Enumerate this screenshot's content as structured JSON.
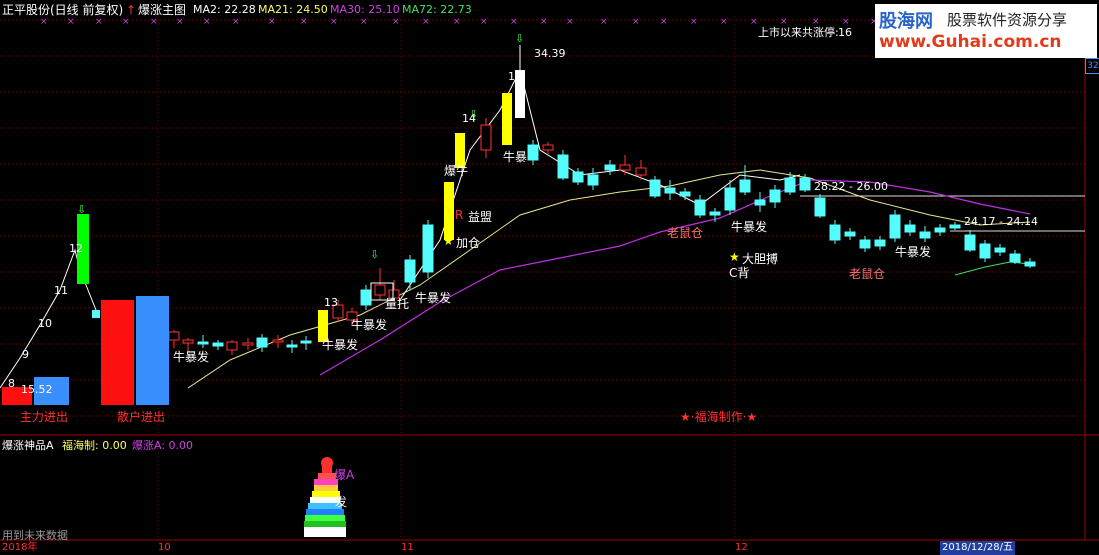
{
  "header": {
    "stock_title": "正平股份(日线 前复权)",
    "indicator_name": "爆涨主图",
    "ma2": "MA2: 22.28",
    "ma21": "MA21: 24.50",
    "ma30": "MA30: 25.10",
    "ma72": "MA72: 22.73"
  },
  "limit_info": {
    "label": "上市以来共涨停:",
    "count": "16"
  },
  "logo": {
    "line1": "股海网",
    "line2": "股票软件资源分享",
    "line3": "www.Guhai.com.cn"
  },
  "scale_tag": "32",
  "annotations": {
    "main_force": "主力进出",
    "retail": "散户进出",
    "price_low": "15.52",
    "price_high": "34.39",
    "range1": "28.22 - 26.00",
    "range2": "24.17 - 24.14",
    "credit": "★·福海制作·★",
    "big_bull": "爆牛",
    "profit": "益盟",
    "add_pos": "加仓",
    "lift": "托",
    "tian_lift": "量托",
    "bold_fight": "大胆搏",
    "c_back": "C背",
    "rat1": "老鼠仓",
    "rat2": "老鼠仓",
    "bull_labels": [
      "牛暴发",
      "牛暴发",
      "牛暴发",
      "牛暴发",
      "牛暴发",
      "牛暴发",
      "牛暴发",
      "牛暴"
    ],
    "step_labels": [
      "8",
      "9",
      "10",
      "11",
      "12",
      "13",
      "14",
      "15"
    ]
  },
  "sub_panel": {
    "title": "爆涨神品A",
    "fuhai": "福海制: 0.00",
    "baozhang": "爆涨A: 0.00",
    "label_a": "爆A",
    "label_fa": "发",
    "footer_note": "用到未来数据"
  },
  "time_axis": [
    "2018年",
    "10",
    "11",
    "12",
    "2018/12/28/五"
  ],
  "colors": {
    "up": "#ff3232",
    "down": "#54fcfc",
    "yellow": "#ffff00",
    "green": "#00ff00",
    "ma_yellow": "#e8e890",
    "ma_purple": "#c030e0",
    "label_red": "#ff3030"
  }
}
